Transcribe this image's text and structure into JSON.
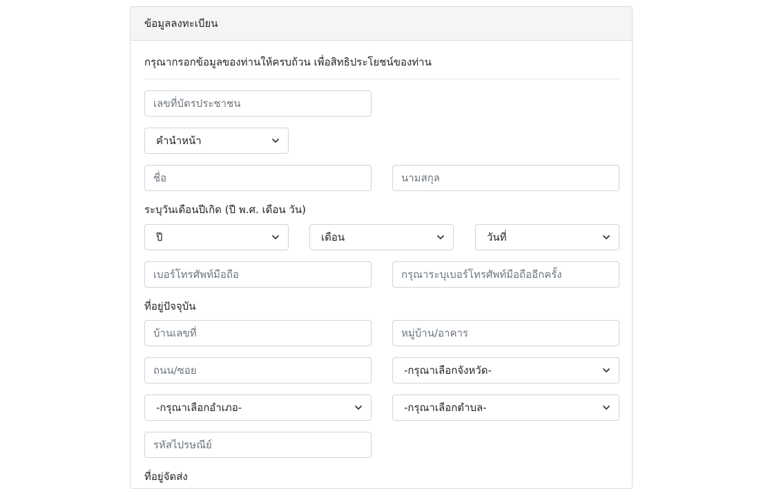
{
  "card": {
    "title": "ข้อมูลลงทะเบียน",
    "instruction": "กรุณากรอกข้อมูลของท่านให้ครบถ้วน เพื่อสิทธิประโยชน์ของท่าน"
  },
  "form": {
    "id_card_placeholder": "เลขที่บัตรประชาชน",
    "title_select": "คำนำหน้า",
    "first_name_placeholder": "ชื่อ",
    "last_name_placeholder": "นามสกุล",
    "birthdate_label": "ระบุวันเดือนปีเกิด (ปี พ.ศ. เดือน วัน)",
    "year_select": "ปี",
    "month_select": "เดือน",
    "day_select": "วันที่",
    "mobile_placeholder": "เบอร์โทรศัพท์มือถือ",
    "mobile_confirm_placeholder": "กรุณาระบุเบอร์โทรศัพท์มือถืออีกครั้ง",
    "address_label": "ที่อยู่ปัจจุบัน",
    "house_no_placeholder": "บ้านเลขที่",
    "village_placeholder": "หมู่บ้าน/อาคาร",
    "road_placeholder": "ถนน/ซอย",
    "province_select": "-กรุณาเลือกจังหวัด-",
    "district_select": "-กรุณาเลือกอำเภอ-",
    "subdistrict_select": "-กรุณาเลือกตำบล-",
    "postcode_placeholder": "รหัสไปรษณีย์",
    "next_section_label": "ที่อยู่จัดส่ง"
  },
  "icons": {
    "select_arrow": "chevron-down-icon"
  }
}
